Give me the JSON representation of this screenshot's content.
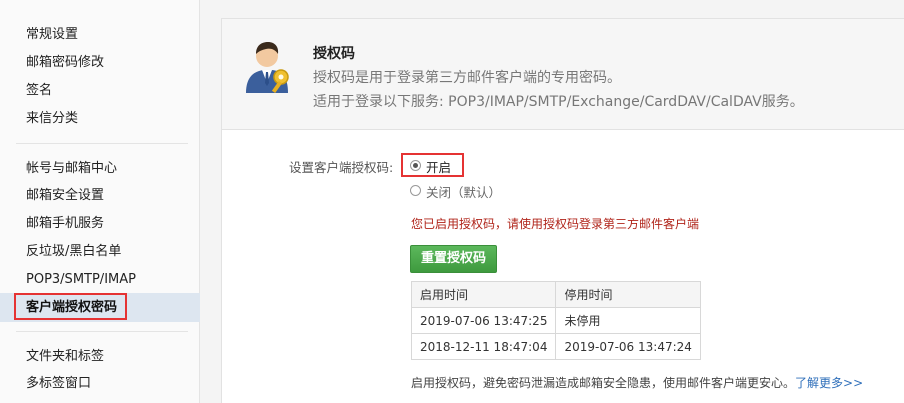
{
  "sidebar": {
    "group1": [
      "常规设置",
      "邮箱密码修改",
      "签名",
      "来信分类"
    ],
    "group2": [
      "帐号与邮箱中心",
      "邮箱安全设置",
      "邮箱手机服务",
      "反垃圾/黑白名单",
      "POP3/SMTP/IMAP"
    ],
    "active_item": "客户端授权密码",
    "group3": [
      "文件夹和标签",
      "多标签窗口"
    ]
  },
  "header": {
    "title": "授权码",
    "line1": "授权码是用于登录第三方邮件客户端的专用密码。",
    "line2": "适用于登录以下服务: POP3/IMAP/SMTP/Exchange/CardDAV/CalDAV服务。",
    "icon": "user-key-icon"
  },
  "setting": {
    "label": "设置客户端授权码:",
    "option_on": "开启",
    "option_off": "关闭（默认）",
    "selected": "开启",
    "notice": "您已启用授权码，请使用授权码登录第三方邮件客户端",
    "reset_button": "重置授权码"
  },
  "times_table": {
    "headers": [
      "启用时间",
      "停用时间"
    ],
    "rows": [
      [
        "2019-07-06 13:47:25",
        "未停用"
      ],
      [
        "2018-12-11 18:47:04",
        "2019-07-06 13:47:24"
      ]
    ]
  },
  "footer": {
    "text": "启用授权码，避免密码泄漏造成邮箱安全隐患，使用邮件客户端更安心。",
    "link": "了解更多>>"
  },
  "colors": {
    "highlight_border": "#e53333",
    "button_green": "#4cae4c",
    "notice_red": "#b0241a",
    "link_blue": "#2f6fba"
  }
}
